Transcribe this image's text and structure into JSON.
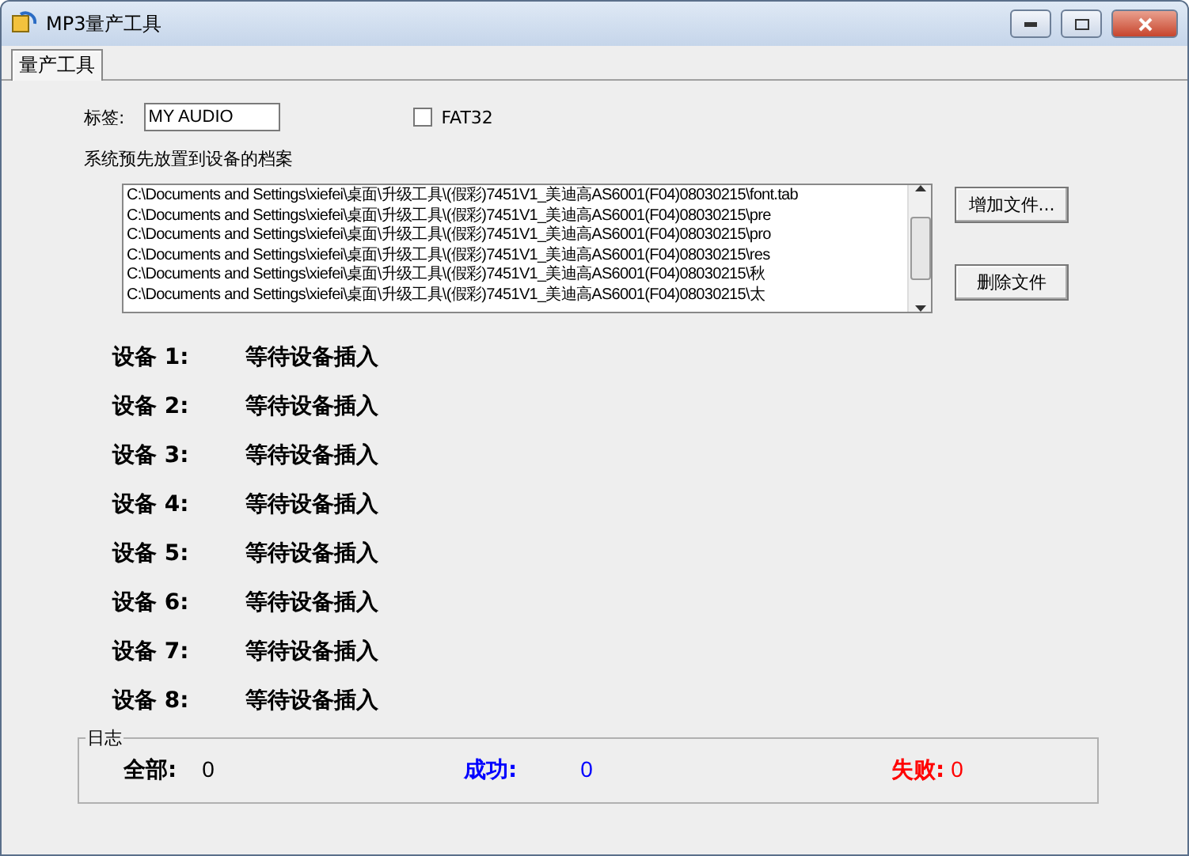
{
  "window": {
    "title": "MP3量产工具"
  },
  "tabs": [
    {
      "label": "量产工具",
      "selected": true
    }
  ],
  "label_field": {
    "label": "标签:",
    "value": "MY AUDIO"
  },
  "fat32": {
    "label": "FAT32",
    "checked": false
  },
  "files": {
    "heading": "系统预先放置到设备的档案",
    "items": [
      "C:\\Documents and Settings\\xiefei\\桌面\\升级工具\\(假彩)7451V1_美迪高AS6001(F04)08030215\\font.tab",
      "C:\\Documents and Settings\\xiefei\\桌面\\升级工具\\(假彩)7451V1_美迪高AS6001(F04)08030215\\pre",
      "C:\\Documents and Settings\\xiefei\\桌面\\升级工具\\(假彩)7451V1_美迪高AS6001(F04)08030215\\pro",
      "C:\\Documents and Settings\\xiefei\\桌面\\升级工具\\(假彩)7451V1_美迪高AS6001(F04)08030215\\res",
      "C:\\Documents and Settings\\xiefei\\桌面\\升级工具\\(假彩)7451V1_美迪高AS6001(F04)08030215\\秋",
      "C:\\Documents and Settings\\xiefei\\桌面\\升级工具\\(假彩)7451V1_美迪高AS6001(F04)08030215\\太"
    ],
    "buttons": [
      "增加文件...",
      "删除文件"
    ]
  },
  "devices": [
    {
      "name": "设备 1:",
      "status": "等待设备插入"
    },
    {
      "name": "设备 2:",
      "status": "等待设备插入"
    },
    {
      "name": "设备 3:",
      "status": "等待设备插入"
    },
    {
      "name": "设备 4:",
      "status": "等待设备插入"
    },
    {
      "name": "设备 5:",
      "status": "等待设备插入"
    },
    {
      "name": "设备 6:",
      "status": "等待设备插入"
    },
    {
      "name": "设备 7:",
      "status": "等待设备插入"
    },
    {
      "name": "设备 8:",
      "status": "等待设备插入"
    }
  ],
  "log": {
    "title": "日志",
    "stats": [
      {
        "label": "全部:",
        "value": "0",
        "color": "#000000"
      },
      {
        "label": "成功:",
        "value": "0",
        "color": "#0000ff"
      },
      {
        "label": "失败:",
        "value": "0",
        "color": "#ff0000"
      }
    ]
  }
}
